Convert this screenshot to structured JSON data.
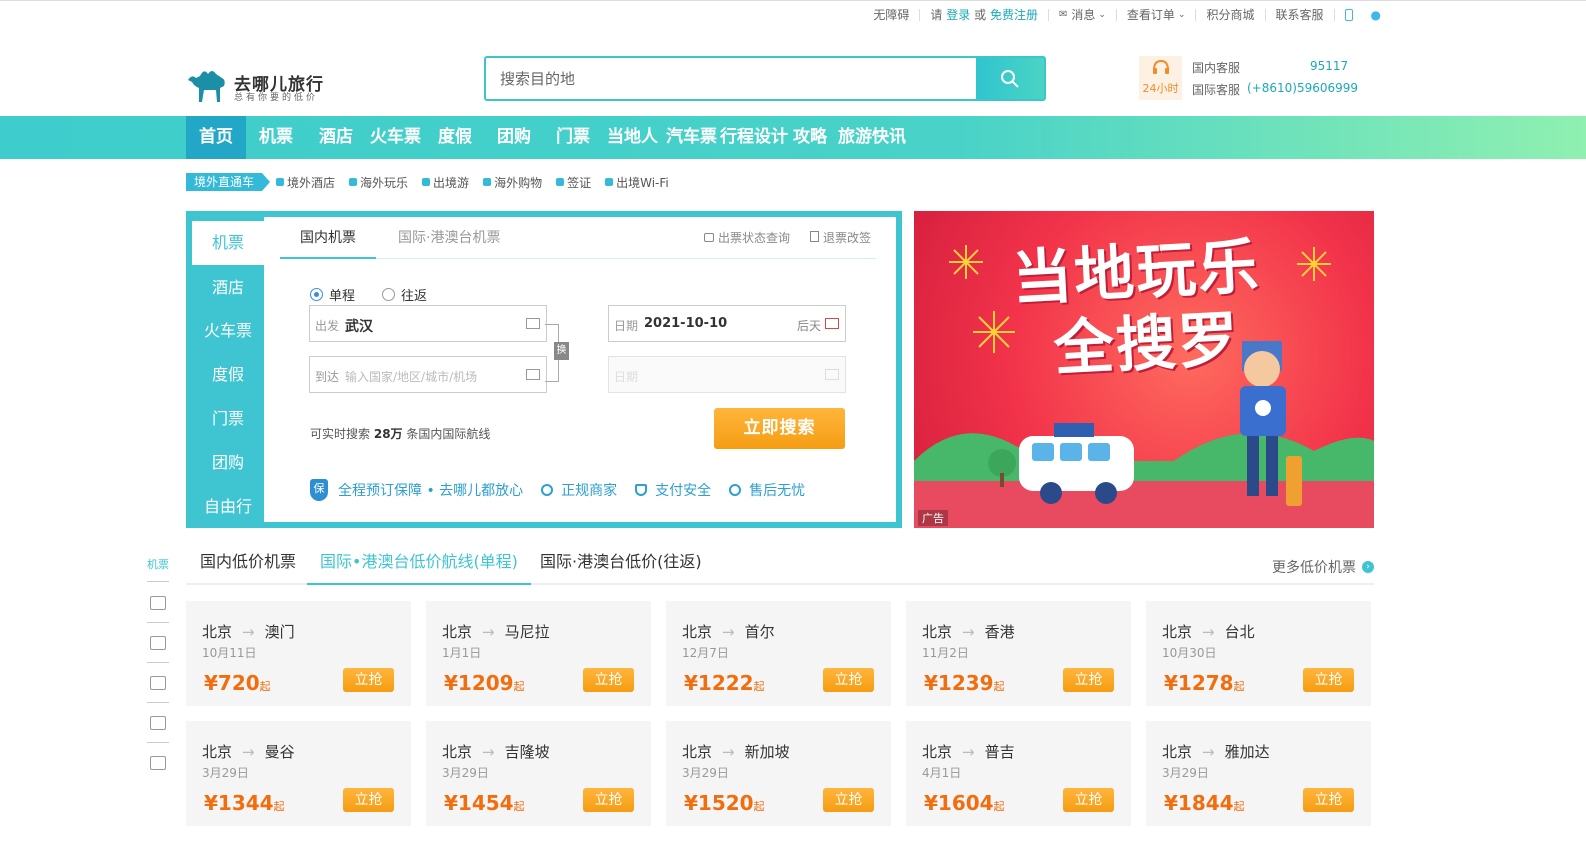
{
  "topbar": {
    "accessibility": "无障碍",
    "please": "请",
    "login": "登录",
    "or": "或",
    "register": "免费注册",
    "messages": "消息",
    "orders": "查看订单",
    "points_mall": "积分商城",
    "contact": "联系客服"
  },
  "header": {
    "logo_name": "去哪儿旅行",
    "logo_slogan": "总有你要的低价",
    "search_placeholder": "搜索目的地",
    "service_badge": "24小时",
    "domestic_label": "国内客服",
    "domestic_number": "95117",
    "intl_label": "国际客服",
    "intl_number": "(+8610)59606999"
  },
  "nav": [
    "首页",
    "机票",
    "酒店",
    "火车票",
    "度假",
    "团购",
    "门票",
    "当地人",
    "汽车票",
    "行程设计",
    "攻略",
    "旅游快讯"
  ],
  "subnav": {
    "tag": "境外直通车",
    "items": [
      "境外酒店",
      "海外玩乐",
      "出境游",
      "海外购物",
      "签证",
      "出境Wi-Fi"
    ]
  },
  "booking": {
    "side": [
      "机票",
      "酒店",
      "火车票",
      "度假",
      "门票",
      "团购",
      "自由行"
    ],
    "tabs": [
      "国内机票",
      "国际·港澳台机票"
    ],
    "links": [
      "出票状态查询",
      "退票改签"
    ],
    "trip_types": [
      "单程",
      "往返"
    ],
    "from_label": "出发",
    "from_value": "武汉",
    "to_label": "到达",
    "to_placeholder": "输入国家/地区/城市/机场",
    "swap": "换",
    "date_label": "日期",
    "date_value": "2021-10-10",
    "date_hint": "后天",
    "return_label": "日期",
    "stat_prefix": "可实时搜索",
    "stat_count": "28万",
    "stat_suffix": "条国内国际航线",
    "search_button": "立即搜索",
    "guarantees": [
      "全程预订保障 • 去哪儿都放心",
      "正规商家",
      "支付安全",
      "售后无忧"
    ],
    "shield_char": "保"
  },
  "banner": {
    "line1": "当地玩乐",
    "line2": "全搜罗",
    "ad": "广告"
  },
  "flights": {
    "tabs": [
      "国内低价机票",
      "国际•港澳台低价航线(单程)",
      "国际·港澳台低价(往返)"
    ],
    "more": "更多低价机票",
    "side_label": "机票",
    "buy_label": "立抢",
    "price_suffix": "起",
    "currency": "¥",
    "cards": [
      {
        "from": "北京",
        "to": "澳门",
        "date": "10月11日",
        "price": "720"
      },
      {
        "from": "北京",
        "to": "马尼拉",
        "date": "1月1日",
        "price": "1209"
      },
      {
        "from": "北京",
        "to": "首尔",
        "date": "12月7日",
        "price": "1222"
      },
      {
        "from": "北京",
        "to": "香港",
        "date": "11月2日",
        "price": "1239"
      },
      {
        "from": "北京",
        "to": "台北",
        "date": "10月30日",
        "price": "1278"
      },
      {
        "from": "北京",
        "to": "曼谷",
        "date": "3月29日",
        "price": "1344"
      },
      {
        "from": "北京",
        "to": "吉隆坡",
        "date": "3月29日",
        "price": "1454"
      },
      {
        "from": "北京",
        "to": "新加坡",
        "date": "3月29日",
        "price": "1520"
      },
      {
        "from": "北京",
        "to": "普吉",
        "date": "4月1日",
        "price": "1604"
      },
      {
        "from": "北京",
        "to": "雅加达",
        "date": "3月29日",
        "price": "1844"
      }
    ]
  }
}
